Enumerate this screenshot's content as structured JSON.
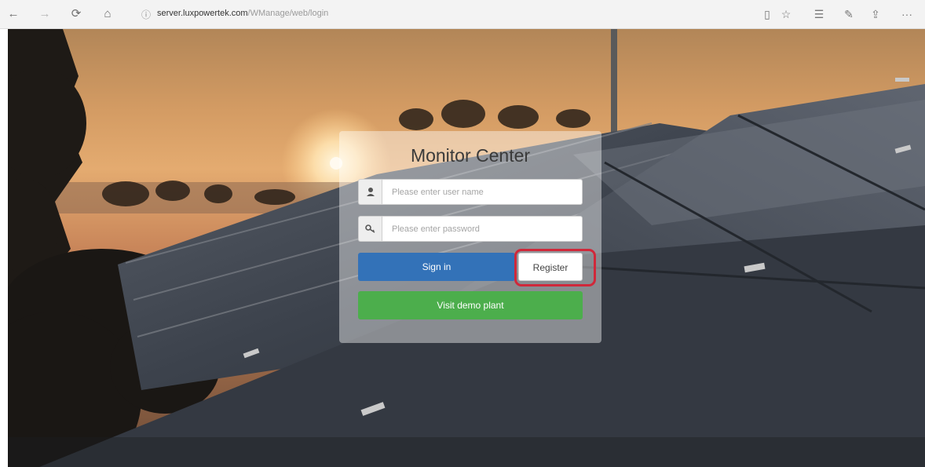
{
  "browser": {
    "url_host": "server.luxpowertek.com",
    "url_path": "/WManage/web/login",
    "nav": {
      "back": "←",
      "forward": "→",
      "refresh": "⟳",
      "home": "⌂"
    },
    "tools": {
      "reading": "▯",
      "favorite": "☆",
      "favorites_list": "☰",
      "notes": "✎",
      "share": "⇪",
      "more": "···"
    }
  },
  "login": {
    "title": "Monitor Center",
    "username_placeholder": "Please enter user name",
    "password_placeholder": "Please enter password",
    "sign_in_label": "Sign in",
    "register_label": "Register",
    "demo_label": "Visit demo plant"
  },
  "colors": {
    "sign_in": "#3372b8",
    "demo": "#4cae4c",
    "highlight": "#d0283a"
  }
}
